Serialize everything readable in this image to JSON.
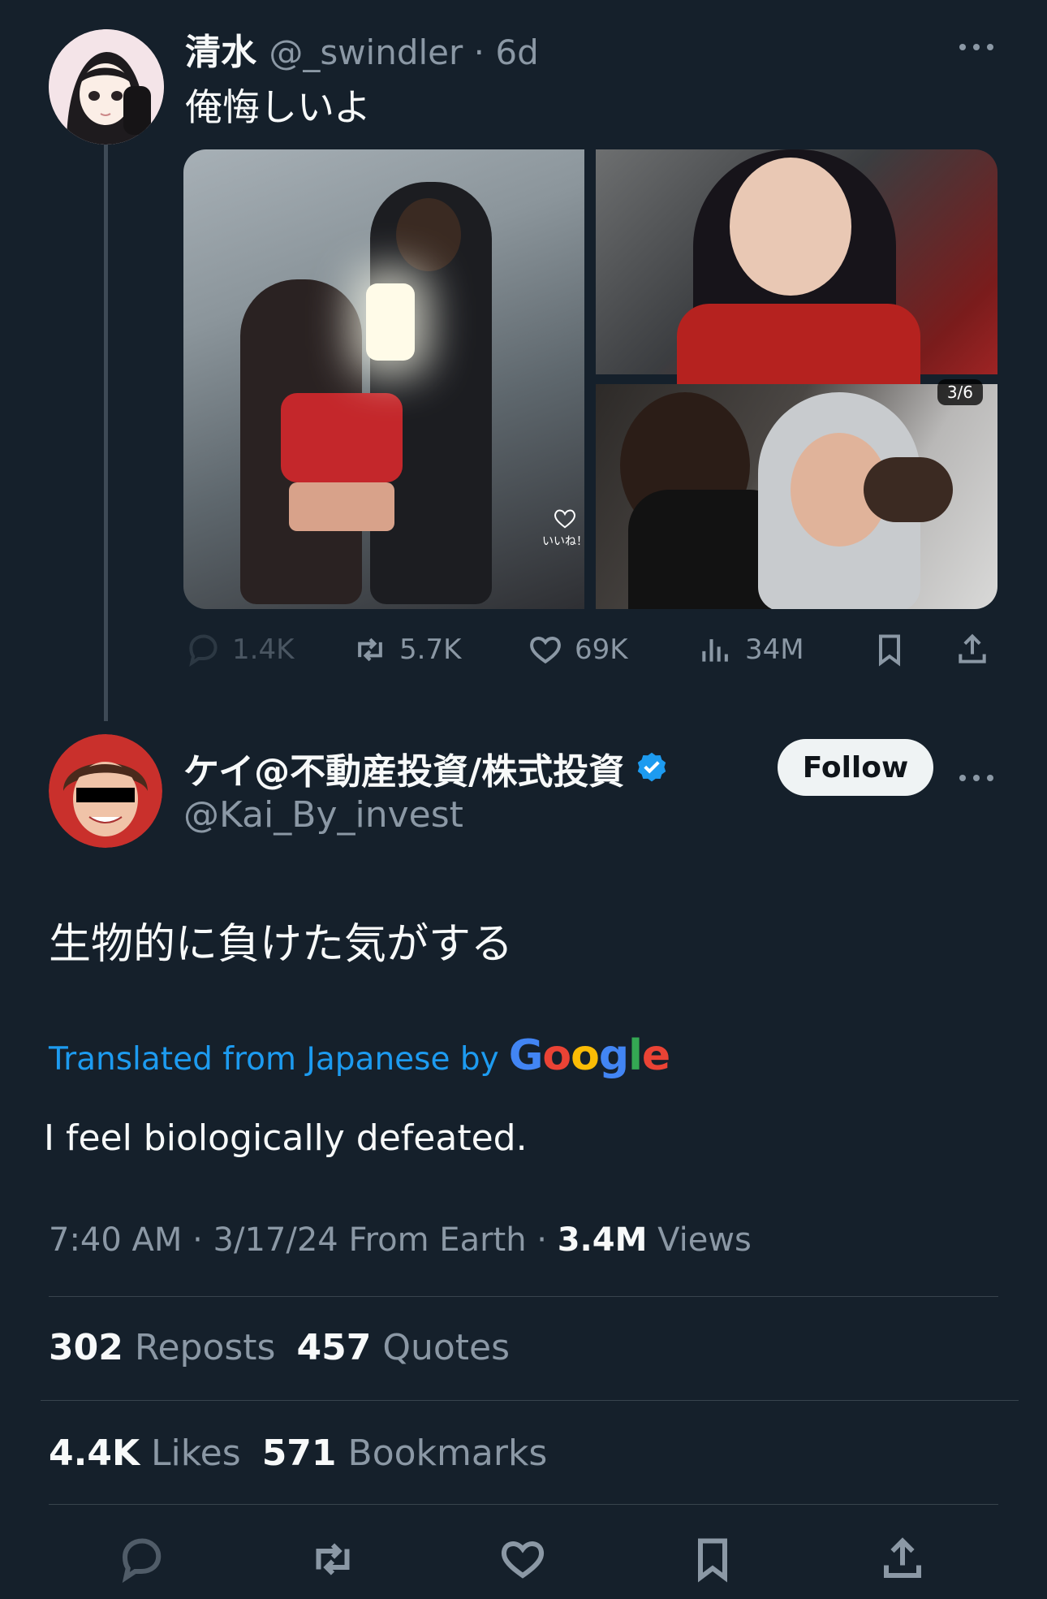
{
  "quoted_tweet": {
    "display_name": "清水",
    "handle": "@_swindler",
    "time_sep": " · ",
    "time": "6d",
    "text": "俺悔しいよ",
    "image_counter": "3/6",
    "image_overlay_like": "いいね！",
    "actions": {
      "replies": "1.4K",
      "reposts": "5.7K",
      "likes": "69K",
      "views": "34M"
    }
  },
  "main_tweet": {
    "display_name": "ケイ@不動産投資/株式投資",
    "handle": "@Kai_By_invest",
    "follow_label": "Follow",
    "text": "生物的に負けた気がする",
    "translated_label": "Translated from Japanese by",
    "translator": "Google",
    "translation": "I feel biologically defeated.",
    "timestamp": "7:40 AM · 3/17/24 From Earth · ",
    "views_count": "3.4M",
    "views_label": " Views",
    "reposts_count": "302",
    "reposts_label": " Reposts",
    "quotes_count": "457",
    "quotes_label": " Quotes",
    "likes_count": "4.4K",
    "likes_label": " Likes",
    "bookmarks_count": "571",
    "bookmarks_label": " Bookmarks"
  },
  "colors": {
    "background": "#15202b",
    "accent": "#1d9bf0",
    "muted": "#8b98a5",
    "text": "#f7f9f9"
  },
  "icons": [
    "reply-icon",
    "repost-icon",
    "like-icon",
    "views-icon",
    "bookmark-icon",
    "share-icon",
    "verified-icon",
    "more-icon"
  ]
}
